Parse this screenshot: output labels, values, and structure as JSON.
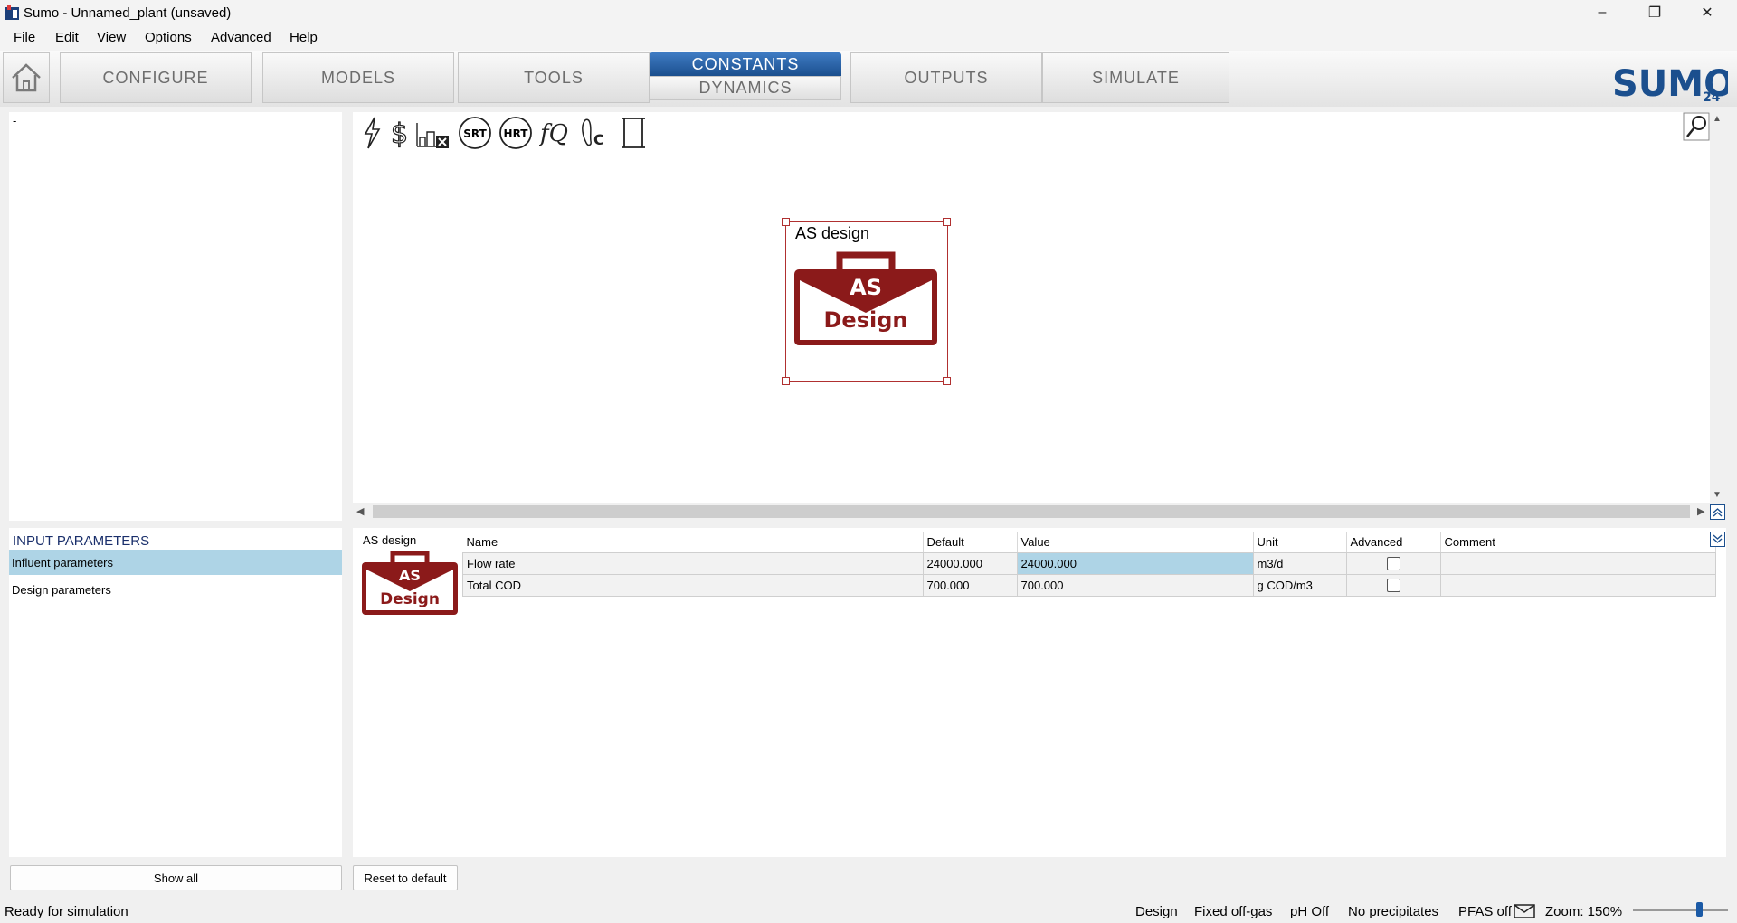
{
  "window": {
    "title": "Sumo - Unnamed_plant (unsaved)",
    "controls": [
      "minimize-icon",
      "restore-icon",
      "close-icon"
    ]
  },
  "menu": [
    "File",
    "Edit",
    "View",
    "Options",
    "Advanced",
    "Help"
  ],
  "nav": {
    "tabs": [
      "CONFIGURE",
      "MODELS",
      "TOOLS",
      "CONSTANTS",
      "DYNAMICS",
      "OUTPUTS",
      "SIMULATE"
    ],
    "active": "CONSTANTS",
    "logo_text": "SUMO",
    "logo_version": "24"
  },
  "tree": {
    "first_item": "-"
  },
  "toolbar_icons": [
    "lightning-icon",
    "dollar-icon",
    "plant-delete-icon",
    "srt-icon",
    "hrt-icon",
    "fq-icon",
    "footprint-c-icon",
    "scroll-icon"
  ],
  "toolbar_labels": {
    "srt": "SRT",
    "hrt": "HRT",
    "fq": "fQ",
    "c": "C"
  },
  "canvas": {
    "block_label": "AS design",
    "icon_line1": "AS",
    "icon_line2": "Design"
  },
  "input_params": {
    "heading": "INPUT PARAMETERS",
    "items": [
      "Influent parameters",
      "Design parameters"
    ],
    "selected": "Influent parameters",
    "show_all": "Show all"
  },
  "grid": {
    "block_name": "AS design",
    "columns": [
      "Name",
      "Default",
      "Value",
      "Unit",
      "Advanced",
      "Comment"
    ],
    "rows": [
      {
        "name": "Flow rate",
        "default": "24000.000",
        "value": "24000.000",
        "unit": "m3/d",
        "advanced": false,
        "comment": ""
      },
      {
        "name": "Total COD",
        "default": "700.000",
        "value": "700.000",
        "unit": "g COD/m3",
        "advanced": false,
        "comment": ""
      }
    ],
    "reset_button": "Reset to default"
  },
  "status": {
    "message": "Ready for simulation",
    "mode": "Design",
    "offgas": "Fixed off-gas",
    "ph": "pH Off",
    "precip": "No precipitates",
    "pfas": "PFAS off",
    "zoom": "Zoom: 150%",
    "zoom_level_percent": 150
  },
  "colors": {
    "accent": "#1b4f8e",
    "brand_red": "#8b1a1a",
    "selection": "#aed4e6"
  }
}
